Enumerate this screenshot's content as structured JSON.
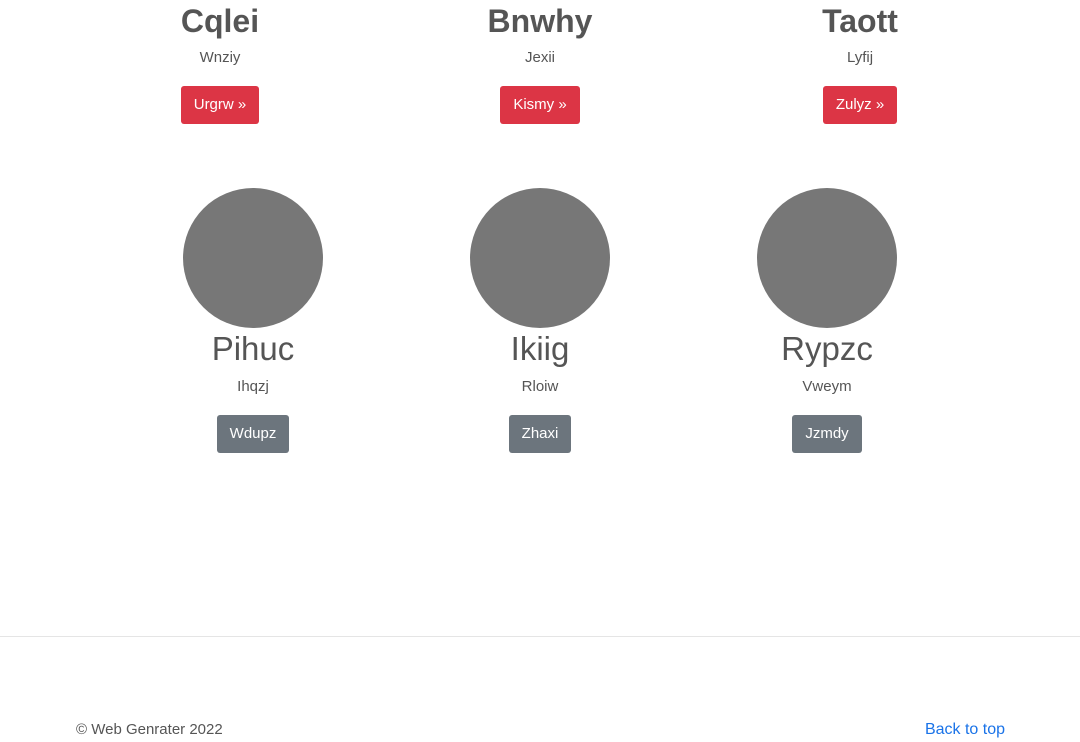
{
  "top_row": [
    {
      "title": "Cqlei",
      "subtitle": "Wnziy",
      "button": "Urgrw »"
    },
    {
      "title": "Bnwhy",
      "subtitle": "Jexii",
      "button": "Kismy »"
    },
    {
      "title": "Taott",
      "subtitle": "Lyfij",
      "button": "Zulyz »"
    }
  ],
  "bottom_row": [
    {
      "title": "Pihuc",
      "subtitle": "Ihqzj",
      "button": "Wdupz"
    },
    {
      "title": "Ikiig",
      "subtitle": "Rloiw",
      "button": "Zhaxi"
    },
    {
      "title": "Rypzc",
      "subtitle": "Vweym",
      "button": "Jzmdy"
    }
  ],
  "footer": {
    "copyright": "© Web Genrater 2022",
    "back_to_top": "Back to top"
  },
  "colors": {
    "primary_button": "#dc3545",
    "secondary_button": "#6c757d",
    "avatar": "#777777",
    "link": "#1a73e8"
  }
}
